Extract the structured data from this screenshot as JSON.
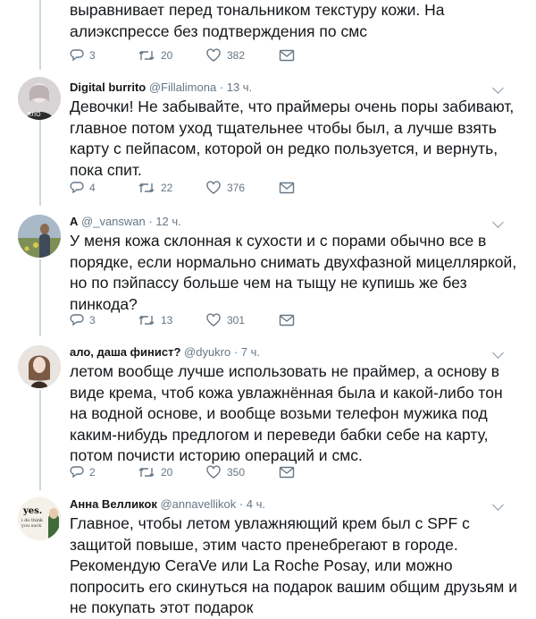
{
  "tweets": [
    {
      "text": "выравнивает перед тональником текстуру кожи. На алиэкспрессе без подтверждения по смс",
      "replies": "3",
      "retweets": "20",
      "likes": "382"
    },
    {
      "name": "Digital burrito",
      "handle": "@Fillalimona",
      "time": "· 13 ч.",
      "text": "Девочки! Не забывайте, что праймеры очень поры забивают, главное потом уход тщательнее чтобы был, а лучше взять карту с пейпасом, которой он редко пользуется, и вернуть, пока спит.",
      "replies": "4",
      "retweets": "22",
      "likes": "376"
    },
    {
      "name": "A",
      "handle": "@_vanswan",
      "time": "· 12 ч.",
      "text": "У меня кожа склонная к сухости и с порами обычно все в порядке, если нормально снимать двухфазной мицелляркой, но по пэйпассу больше чем на тыщу не купишь же без пинкода?",
      "replies": "3",
      "retweets": "13",
      "likes": "301"
    },
    {
      "name": "ало, даша финист?",
      "handle": "@dyukro",
      "time": "· 7 ч.",
      "text": "летом вообще лучше использовать не праймер, а основу в виде крема, чтоб кожа увлажнённая была и какой-либо тон на водной основе, и вообще возьми телефон мужика под каким-нибудь предлогом и переведи бабки себе на карту, потом почисти историю операций и смс.",
      "replies": "2",
      "retweets": "20",
      "likes": "350"
    },
    {
      "name": "Анна Велликок",
      "handle": "@annavellikok",
      "time": "· 4 ч.",
      "text": "Главное, чтобы летом увлажняющий крем был с SPF с защитой повыше, этим часто пренебрегают в городе. Рекомендую CeraVe или La Roche Posay, или можно попросить его скинуться на подарок вашим общим друзьям и не покупать этот подарок",
      "avatar_text": "yes. i do think you suck"
    }
  ],
  "colors": {
    "muted": "#657786",
    "line": "#ccd6dd",
    "text": "#14171a"
  }
}
